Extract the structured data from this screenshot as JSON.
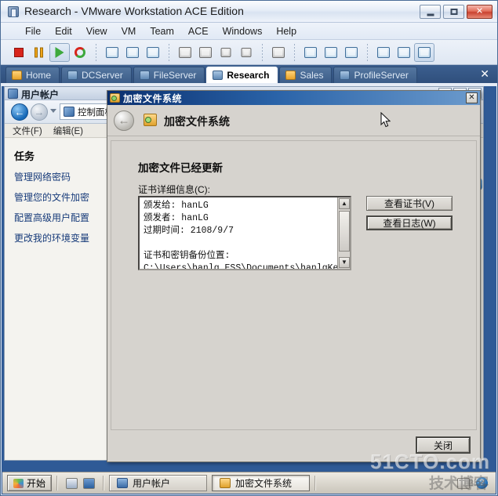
{
  "window": {
    "title": "Research - VMware Workstation ACE Edition",
    "icon": "vmware-icon",
    "controls": {
      "minimize": "minimize-icon",
      "maximize": "maximize-icon",
      "close": "✕"
    }
  },
  "menubar": {
    "items": [
      "File",
      "Edit",
      "View",
      "VM",
      "Team",
      "ACE",
      "Windows",
      "Help"
    ]
  },
  "toolbar": {
    "items": [
      {
        "name": "power-off-icon"
      },
      {
        "name": "suspend-icon"
      },
      {
        "name": "power-on-icon",
        "selected": true
      },
      {
        "name": "reset-icon"
      },
      {
        "name": "snapshot-take-icon"
      },
      {
        "name": "snapshot-revert-icon"
      },
      {
        "name": "snapshot-manager-icon"
      },
      {
        "name": "clone-icon"
      },
      {
        "name": "clone-multi-icon"
      },
      {
        "name": "new-vm-icon"
      },
      {
        "name": "delete-vm-icon"
      },
      {
        "name": "summary-icon"
      },
      {
        "name": "show-sidebar-icon"
      },
      {
        "name": "quick-switch-icon"
      },
      {
        "name": "fullscreen-icon"
      },
      {
        "name": "settings-icon"
      },
      {
        "name": "console-icon"
      },
      {
        "name": "multiple-windows-icon",
        "selected": true
      }
    ]
  },
  "tabs": {
    "items": [
      {
        "label": "Home",
        "icon": "home-icon",
        "active": false
      },
      {
        "label": "DCServer",
        "icon": "vm-icon",
        "active": false
      },
      {
        "label": "FileServer",
        "icon": "vm-icon",
        "active": false
      },
      {
        "label": "Research",
        "icon": "vm-icon",
        "active": true
      },
      {
        "label": "Sales",
        "icon": "vm-icon",
        "active": false
      },
      {
        "label": "ProfileServer",
        "icon": "vm-icon",
        "active": false
      }
    ],
    "close_label": "✕"
  },
  "control_panel": {
    "title": "用户帐户",
    "window_buttons": [
      "–",
      "□",
      "✕"
    ],
    "nav": {
      "back": "←",
      "forward": "→",
      "address_value": "控制面板"
    },
    "menu": [
      "文件(F)",
      "编辑(E)"
    ],
    "sidebar": {
      "heading": "任务",
      "links": [
        "管理网络密码",
        "管理您的文件加密",
        "配置高级用户配置",
        "更改我的环境变量"
      ]
    }
  },
  "efs_dialog": {
    "title": "加密文件系统",
    "close_label": "✕",
    "header_title": "加密文件系统",
    "back_arrow": "←",
    "heading": "加密文件已经更新",
    "cert_label": "证书详细信息(C):",
    "cert_details": "颁发给: hanLG\n颁发者: hanLG\n过期时间: 2108/9/7\n\n证书和密钥备份位置:\nC:\\Users\\hanlg.ESS\\Documents\\hanlgKey.pfx",
    "scrollbar": {
      "up": "▲",
      "down": "▼"
    },
    "buttons": {
      "view_cert": "查看证书(V)",
      "view_log": "查看日志(W)",
      "close": "关闭"
    }
  },
  "taskbar": {
    "start_label": "开始",
    "quick_launch": [
      "show-desktop-icon",
      "switch-window-icon"
    ],
    "items": [
      {
        "label": "用户帐户",
        "icon": "users-icon",
        "active": false
      },
      {
        "label": "加密文件系统",
        "icon": "efs-icon",
        "active": true
      }
    ],
    "tray": [
      {
        "name": "keyboard-layout-icon",
        "label": ""
      },
      {
        "name": "help-icon",
        "label": "?"
      }
    ]
  },
  "watermark": {
    "line1": "51CTO.com",
    "line2": "技术博客",
    "line3": "Blog"
  },
  "colors": {
    "titlebar_accent": "#0a2f6e",
    "tabstrip": "#2f4f7c",
    "dialog_face": "#d6d3ce",
    "link": "#173b7a",
    "close_button": "#c9422f"
  }
}
